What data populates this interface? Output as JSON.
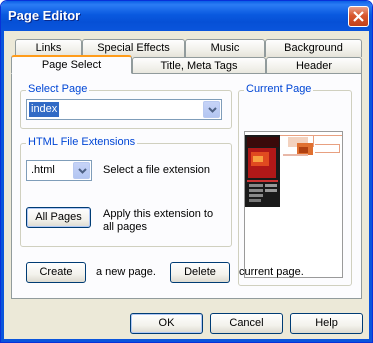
{
  "window": {
    "title": "Page Editor"
  },
  "tabs_back": [
    "Links",
    "Special Effects",
    "Music",
    "Background"
  ],
  "tabs_front": [
    "Page Select",
    "Title, Meta Tags",
    "Header"
  ],
  "select_page": {
    "legend": "Select Page",
    "value": "index"
  },
  "current_page": {
    "legend": "Current Page"
  },
  "html_ext": {
    "legend": "HTML File Extensions",
    "value": ".html",
    "select_hint": "Select a file extension",
    "all_pages_label": "All Pages",
    "apply_text_1": "Apply this extension to",
    "apply_text_2": "all pages"
  },
  "page_actions": {
    "create_label": "Create",
    "create_text": "a new page.",
    "delete_label": "Delete",
    "delete_text": "current page."
  },
  "footer": {
    "ok_label": "OK",
    "cancel_label": "Cancel",
    "help_label": "Help"
  },
  "colors": {
    "title_bar": "#0a5ae0",
    "dialog_bg": "#ece9d8",
    "active_tab_accent": "#ff9c1a",
    "group_label": "#0046d5"
  },
  "icons": {
    "close": "close-icon",
    "dropdown": "chevron-down-icon"
  }
}
